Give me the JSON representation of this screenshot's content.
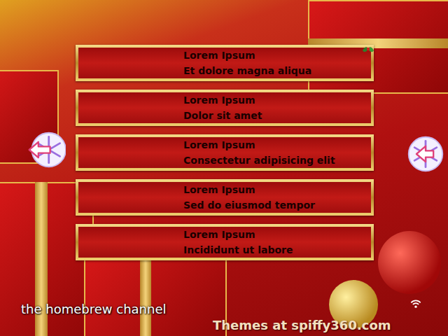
{
  "apps": [
    {
      "name": "Lorem Ipsum",
      "description": "Et dolore magna aliqua"
    },
    {
      "name": "Lorem Ipsum",
      "description": "Dolor sit amet"
    },
    {
      "name": "Lorem Ipsum",
      "description": "Consectetur adipisicing elit"
    },
    {
      "name": "Lorem Ipsum",
      "description": "Sed do eiusmod tempor"
    },
    {
      "name": "Lorem Ipsum",
      "description": "Incididunt ut labore"
    }
  ],
  "branding": {
    "channel": "the homebrew channel",
    "credit": "Themes at spiffy360.com"
  }
}
